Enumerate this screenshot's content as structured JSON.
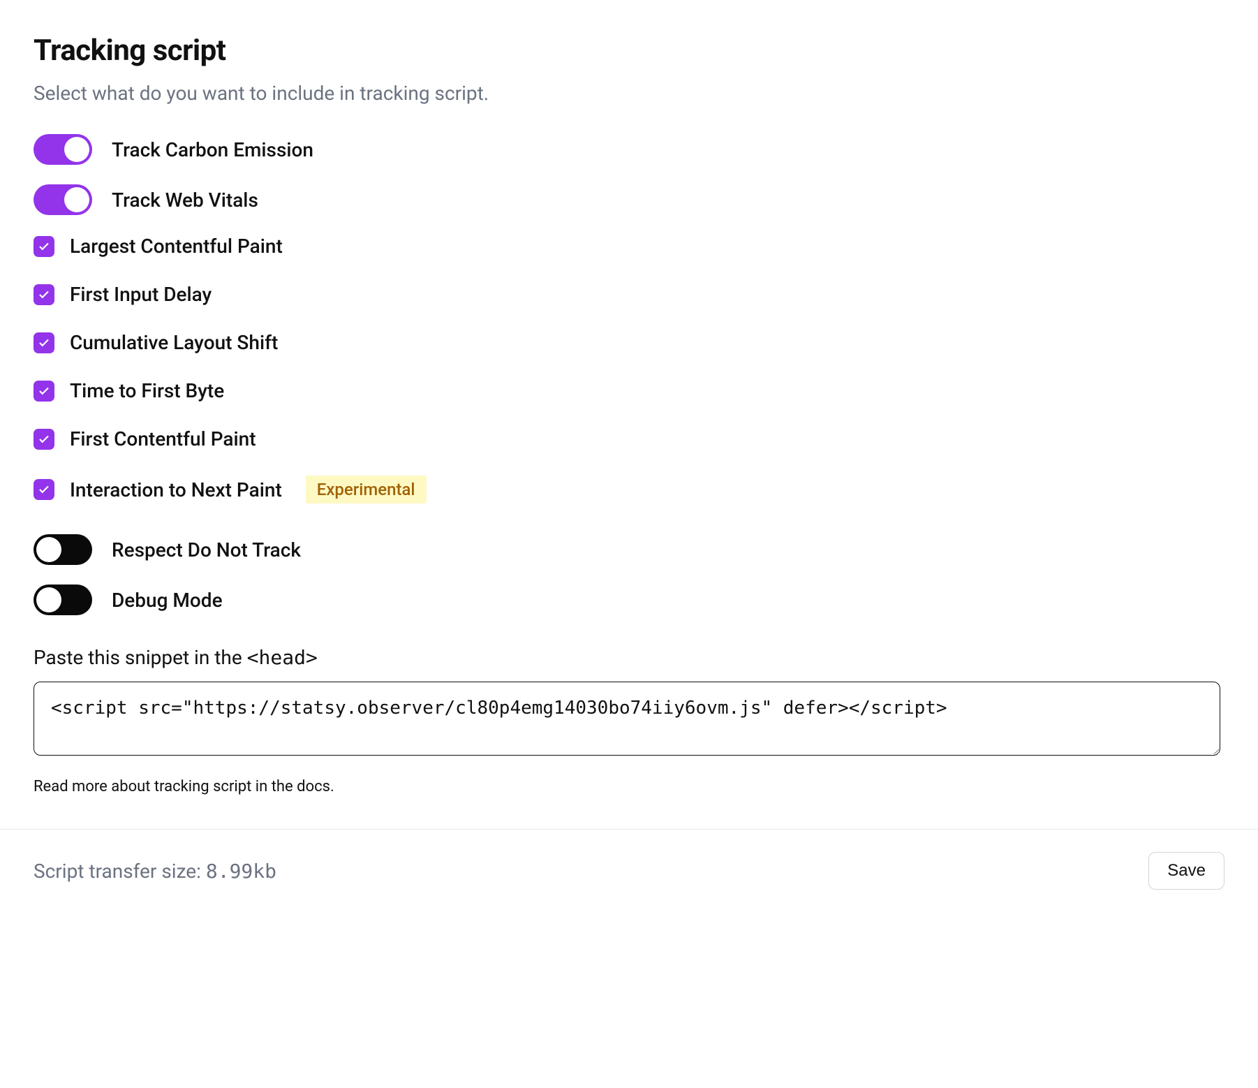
{
  "header": {
    "title": "Tracking script",
    "subtitle": "Select what do you want to include in tracking script."
  },
  "toggles": {
    "carbon": {
      "label": "Track Carbon Emission",
      "on": true
    },
    "webvitals": {
      "label": "Track Web Vitals",
      "on": true
    }
  },
  "checkboxes": [
    {
      "label": "Largest Contentful Paint",
      "checked": true,
      "badge": null
    },
    {
      "label": "First Input Delay",
      "checked": true,
      "badge": null
    },
    {
      "label": "Cumulative Layout Shift",
      "checked": true,
      "badge": null
    },
    {
      "label": "Time to First Byte",
      "checked": true,
      "badge": null
    },
    {
      "label": "First Contentful Paint",
      "checked": true,
      "badge": null
    },
    {
      "label": "Interaction to Next Paint",
      "checked": true,
      "badge": "Experimental"
    }
  ],
  "secondary_toggles": {
    "dnt": {
      "label": "Respect Do Not Track",
      "on": false
    },
    "debug": {
      "label": "Debug Mode",
      "on": false
    }
  },
  "snippet": {
    "label_prefix": "Paste this snippet in the ",
    "label_tag": "<head>",
    "code": "<script src=\"https://statsy.observer/cl80p4emg14030bo74iiy6ovm.js\" defer></script>"
  },
  "docs": {
    "text": "Read more about tracking script in the docs."
  },
  "footer": {
    "size_prefix": "Script transfer size: ",
    "size_value": "8.99kb",
    "save_label": "Save"
  }
}
